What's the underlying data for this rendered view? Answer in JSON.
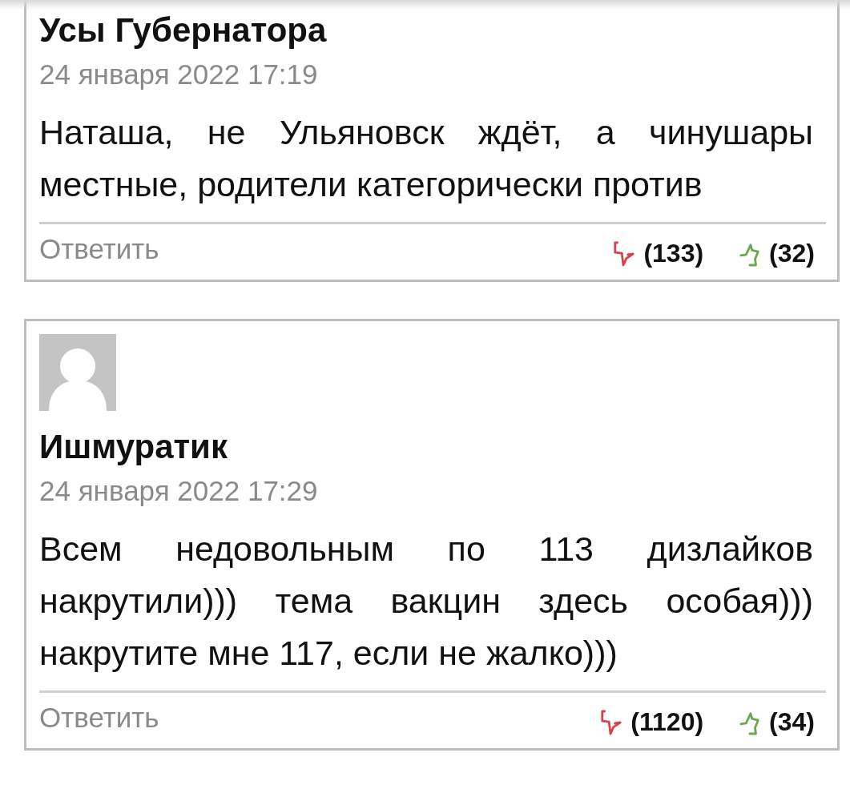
{
  "comments": [
    {
      "show_avatar": false,
      "author": "Усы Губернатора",
      "date": "24 января 2022 17:19",
      "text": "Наташа, не Ульяновск ждёт, а чинушары местные, родители категорически против",
      "reply": "Ответить",
      "dislikes": "(133)",
      "likes": "(32)"
    },
    {
      "show_avatar": true,
      "author": "Ишмуратик",
      "date": "24 января 2022 17:29",
      "text": "Всем недовольным по 113 дизлайков накрутили))) тема вакцин здесь особая))) накрутите мне 117, если не жалко)))",
      "reply": "Ответить",
      "dislikes": "(1120)",
      "likes": "(34)"
    }
  ]
}
